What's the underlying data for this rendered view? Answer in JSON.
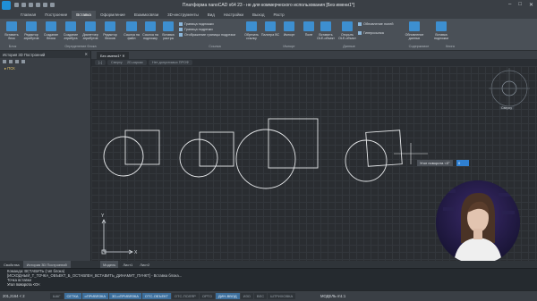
{
  "window": {
    "title": "Платформа nanoCAD x64 23 - не для коммерческого использования [Без имени1*]"
  },
  "menu_tabs": [
    "Главная",
    "Построение",
    "Вставка",
    "Оформление",
    "Взаимосвязи",
    "3D-инструменты",
    "Вид",
    "Настройки",
    "Выход",
    "Растр"
  ],
  "active_tab": "Вставка",
  "ribbon": {
    "buttons": [
      {
        "label": "Вставить блок"
      },
      {
        "label": "Редактор атрибутов"
      },
      {
        "label": "Создание блока"
      },
      {
        "label": "Создание атрибута"
      },
      {
        "label": "Диспетчер атрибутов"
      },
      {
        "label": "Редактор блоков"
      },
      {
        "label": "Ссылка на файл"
      },
      {
        "label": "Ссылка на подложку"
      },
      {
        "label": "Вставка растра"
      },
      {
        "label": "Обрезать ссылку"
      },
      {
        "label": "Палитра ВС"
      },
      {
        "label": "Импорт"
      },
      {
        "label": "Поле"
      },
      {
        "label": "Вставить OLE-объект"
      },
      {
        "label": "Открыть OLE-объект"
      },
      {
        "label": "Обновление данных"
      },
      {
        "label": "Вставка подложки"
      }
    ],
    "small_items": [
      "Граница подложки",
      "Граница подрезки",
      "Отображение границы подрезки",
      "Обновление полей",
      "Гиперссылка"
    ],
    "groups": [
      "Блок",
      "Определение блока",
      "Ссылка",
      "Импорт",
      "Данные",
      "Содержимое",
      "Книга"
    ]
  },
  "left_panel": {
    "header": "История 3D Построений",
    "tree_item": "ПСК",
    "tabs": [
      "Свойства",
      "История 3D Построений"
    ]
  },
  "doc_tab": "Без имени1*",
  "viewport_controls": [
    "Сверху",
    "2D-каркас",
    "Нет допустимых ПРОФ"
  ],
  "canvas": {
    "tooltip_label": "Угол поворота <0°",
    "tooltip_value": "0",
    "viewcube_label": "Сверху",
    "axis_y": "Y",
    "axis_x": "X"
  },
  "layout_tabs": [
    "Модель",
    "Лист1",
    "Лист2"
  ],
  "command_history": [
    "Команда: ВСТАВИТЬ (тип блока)",
    "[ИСХОДНЫЙ_Т_ТОЧКА_ОБЪЕКТ_Б_ОСТАВЛЕН_ВСТАВИТЬ_ДИНАМИТ_ПУНКТ] - Вставка блока...",
    "Точка вставки",
    "Угол поворота <0>:"
  ],
  "status": {
    "coordinates": "201,2164 < 2",
    "modes": [
      "ШАГ",
      "СЕТКА",
      "оПРИВЯЗКА",
      "3D-оПРИВЯЗКА",
      "ОТС-ОБЪЕКТ",
      "ОТС-ПОЛЯР",
      "ОРТО",
      "ДИН-ВВОД",
      "ИЗО",
      "ВЕС",
      "ШТРИХОВКА"
    ],
    "modes_on": [
      "СЕТКА",
      "оПРИВЯЗКА",
      "3D-оПРИВЯЗКА",
      "ОТС-ОБЪЕКТ",
      "ДИН-ВВОД"
    ],
    "right_text": "МОДЕЛЬ   m1:1"
  }
}
